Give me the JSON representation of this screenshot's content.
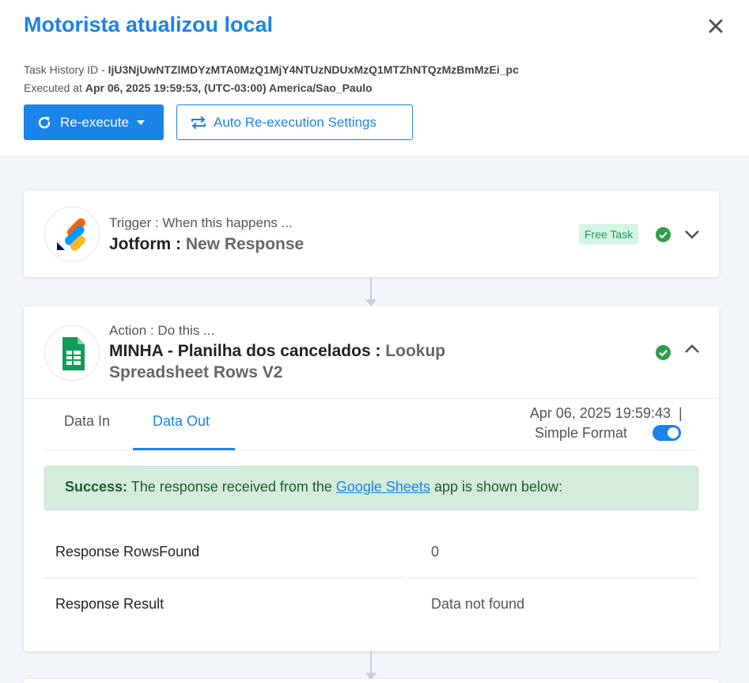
{
  "header": {
    "title": "Motorista atualizou local",
    "task_history_label": "Task History ID - ",
    "task_history_id": "IjU3NjUwNTZlMDYzMTA0MzQ1MjY4NTUzNDUxMzQ1MTZhNTQzMzBmMzEi_pc",
    "executed_label": "Executed at ",
    "executed_value": "Apr 06, 2025 19:59:53, (UTC-03:00) America/Sao_Paulo",
    "reexecute_label": "Re-execute",
    "auto_reexec_label": "Auto Re-execution Settings"
  },
  "trigger": {
    "label": "Trigger : When this happens ...",
    "app": "Jotform : ",
    "event": "New Response",
    "badge": "Free Task",
    "app_icon": "jotform-logo"
  },
  "action": {
    "label": "Action : Do this ...",
    "app": "MINHA - Planilha dos cancelados : ",
    "event": "Lookup Spreadsheet Rows V2",
    "app_icon": "google-sheets-logo",
    "tabs": [
      "Data In",
      "Data Out"
    ],
    "active_tab": "Data Out",
    "timestamp": "Apr 06, 2025 19:59:43",
    "separator": "|",
    "format_label": "Simple Format",
    "simple_format_on": true,
    "alert": {
      "prefix": "Success:",
      "text_before": " The response received from the ",
      "link": "Google Sheets",
      "text_after": " app is shown below:"
    },
    "rows": [
      {
        "key": "Response RowsFound",
        "value": "0"
      },
      {
        "key": "Response Result",
        "value": "Data not found"
      }
    ]
  },
  "colors": {
    "accent": "#1a84e8",
    "success": "#2e9e4a",
    "badge_bg": "#d4f5e5"
  }
}
